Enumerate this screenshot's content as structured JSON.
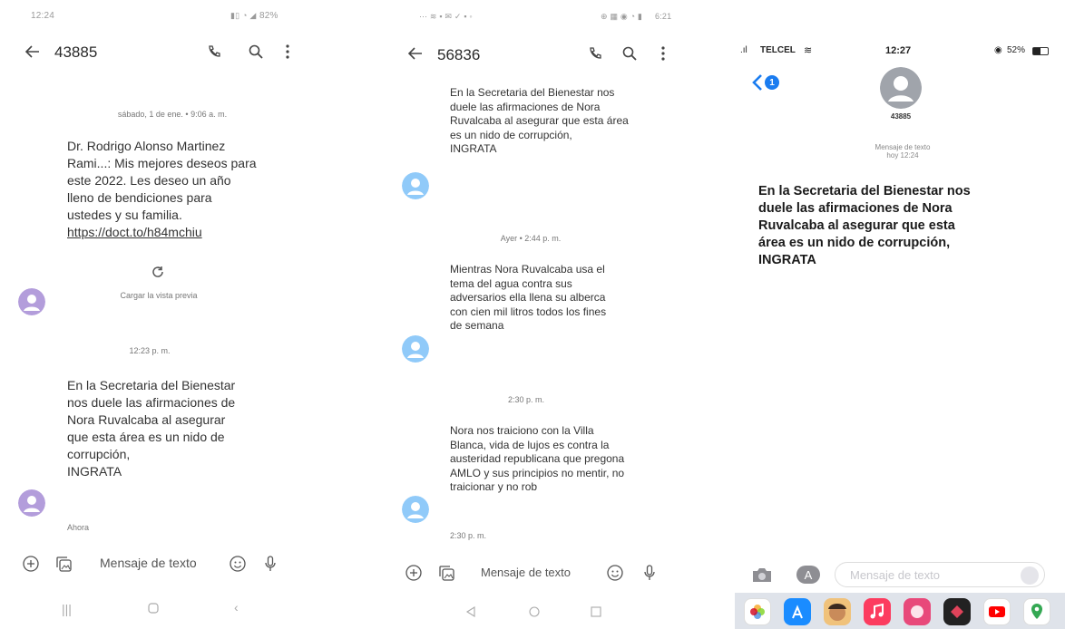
{
  "screen1": {
    "status_time": "12:24",
    "status_right": "82%",
    "contact": "43885",
    "messages": [
      {
        "timestamp": "sábado, 1 de ene. • 9:06 a. m.",
        "text": "Dr. Rodrigo Alonso Martinez Rami...: Mis mejores deseos para este 2022. Les deseo un año lleno de bendiciones para ustedes y su familia.",
        "link": "https://doct.to/h84mchiu",
        "preview_label": "Cargar la vista previa"
      },
      {
        "timestamp": "12:23 p. m.",
        "text": "En la Secretaria del Bienestar nos duele las afirmaciones de Nora Ruvalcaba al asegurar que esta área es un nido de corrupción,\nINGRATA",
        "status": "Ahora"
      }
    ],
    "compose_placeholder": "Mensaje de texto",
    "colors": {
      "avatar": "#b39ddb"
    }
  },
  "screen2": {
    "status_right": "6:21",
    "contact": "56836",
    "messages": [
      {
        "text": "En la Secretaria del Bienestar nos duele las afirmaciones de Nora Ruvalcaba al asegurar que esta área es un nido de corrupción,\nINGRATA"
      },
      {
        "timestamp": "Ayer • 2:44 p. m.",
        "text": "Mientras Nora Ruvalcaba usa el tema del agua contra sus adversarios ella llena su alberca con cien mil litros todos los fines de semana"
      },
      {
        "timestamp": "2:30 p. m.",
        "text": "Nora nos traiciono con la Villa Blanca, vida de lujos es contra la austeridad republicana que pregona AMLO y sus principios no mentir, no traicionar y no rob",
        "status": "2:30 p. m."
      }
    ],
    "compose_placeholder": "Mensaje de texto",
    "colors": {
      "avatar": "#90caf9"
    }
  },
  "screen3": {
    "carrier": "TELCEL",
    "status_time": "12:27",
    "battery": "52%",
    "back_badge": "1",
    "contact": "43885",
    "header_label": "Mensaje de texto",
    "header_time": "hoy 12:24",
    "message": "En la Secretaria del Bienestar nos duele las afirmaciones de Nora Ruvalcaba al asegurar que esta área es un nido de corrupción,\nINGRATA",
    "compose_placeholder": "Mensaje de texto",
    "dock_icons": [
      "photos-icon",
      "app-store-icon",
      "memoji-icon",
      "music-icon",
      "pink-app-icon",
      "dark-app-icon",
      "youtube-icon",
      "maps-icon"
    ],
    "colors": {
      "ios_blue": "#1a7cf0"
    }
  }
}
